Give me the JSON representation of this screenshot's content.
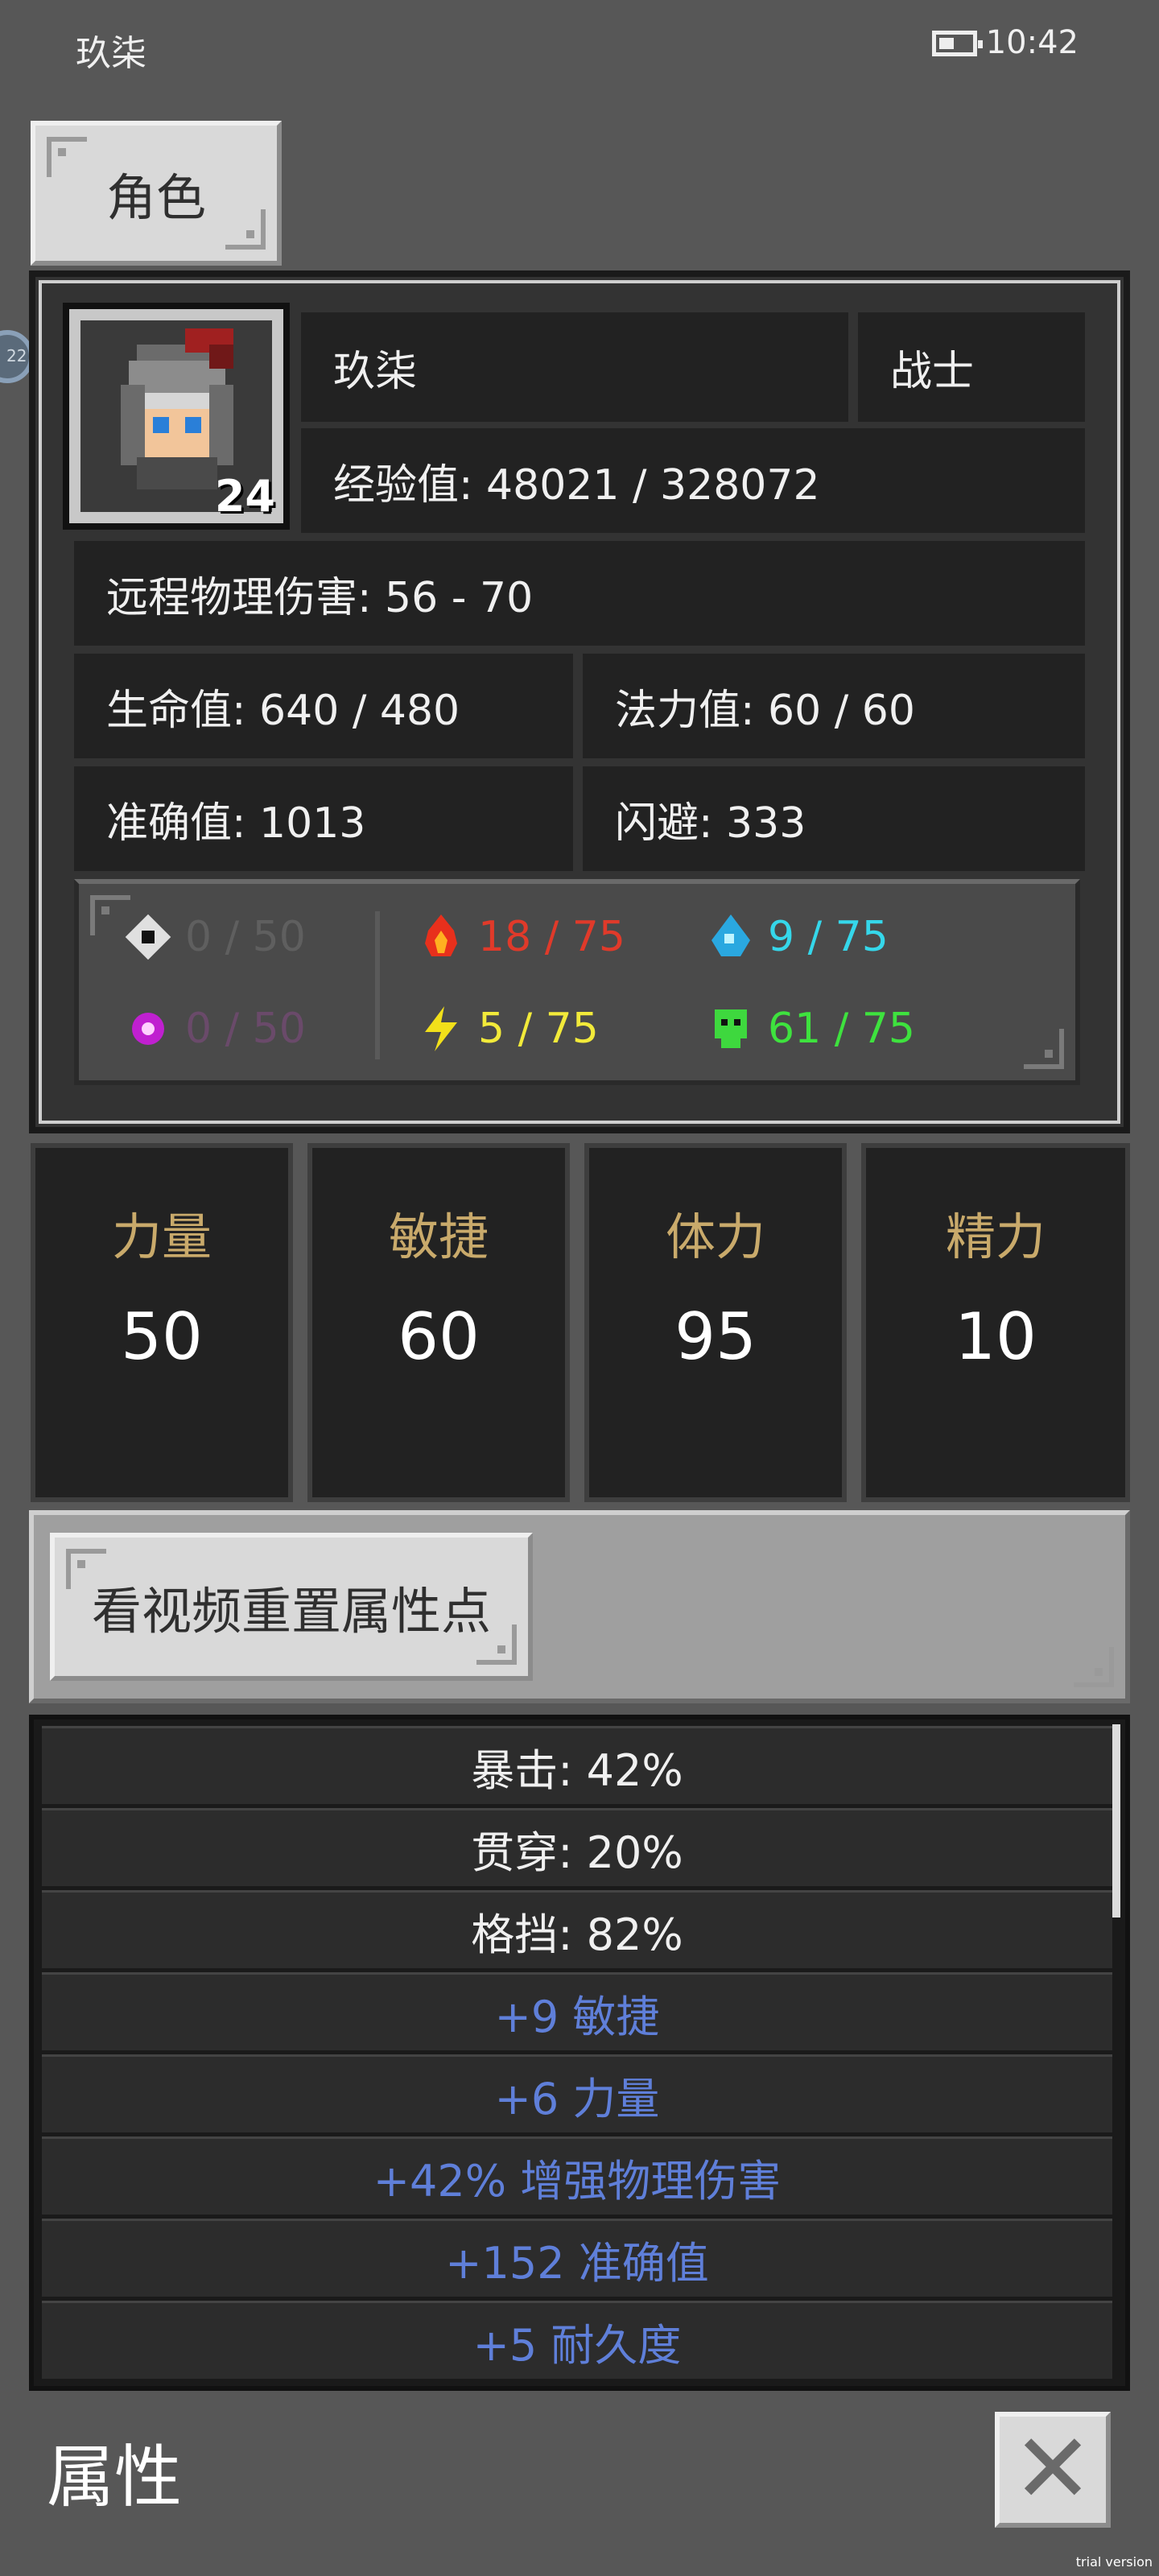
{
  "status_bar": {
    "title": "玖柒",
    "time": "10:42"
  },
  "tab": {
    "label": "角色"
  },
  "character": {
    "level": "24",
    "name": "玖柒",
    "class": "战士",
    "exp": "经验值: 48021 / 328072",
    "damage": "远程物理伤害: 56 - 70",
    "hp": "生命值: 640 / 480",
    "mp": "法力值: 60 / 60",
    "accuracy": "准确值: 1013",
    "dodge": "闪避: 333"
  },
  "resistances": [
    {
      "icon": "physical-shield-icon",
      "value": "0 / 50",
      "color": "#5f5f5f"
    },
    {
      "icon": "fire-icon",
      "value": "18 / 75",
      "color": "#e03a2a"
    },
    {
      "icon": "water-icon",
      "value": "9 / 75",
      "color": "#35d7ea"
    },
    {
      "icon": "arcane-icon",
      "value": "0 / 50",
      "color": "#6a4a6a"
    },
    {
      "icon": "lightning-icon",
      "value": "5 / 75",
      "color": "#f2ea3a"
    },
    {
      "icon": "poison-skull-icon",
      "value": "61 / 75",
      "color": "#3ee23e"
    }
  ],
  "stats": [
    {
      "name": "力量",
      "value": "50"
    },
    {
      "name": "敏捷",
      "value": "60"
    },
    {
      "name": "体力",
      "value": "95"
    },
    {
      "name": "精力",
      "value": "10"
    }
  ],
  "reset": {
    "label": "看视频重置属性点"
  },
  "bonuses": [
    {
      "text": "暴击: 42%",
      "color": "#f0f0f0"
    },
    {
      "text": "贯穿: 20%",
      "color": "#f0f0f0"
    },
    {
      "text": "格挡: 82%",
      "color": "#f0f0f0"
    },
    {
      "text": "+9 敏捷",
      "color": "#5f7fd9"
    },
    {
      "text": "+6 力量",
      "color": "#5f7fd9"
    },
    {
      "text": "+42% 增强物理伤害",
      "color": "#5f7fd9"
    },
    {
      "text": "+152 准确值",
      "color": "#5f7fd9"
    },
    {
      "text": "+5 耐久度",
      "color": "#5f7fd9"
    }
  ],
  "footer": {
    "title": "属性"
  },
  "side_badge": "22",
  "trial": "trial version"
}
